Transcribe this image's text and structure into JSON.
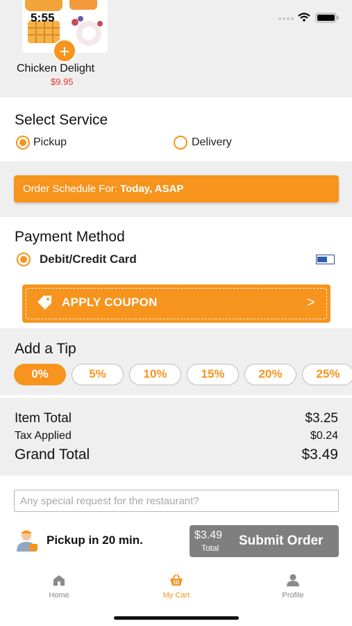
{
  "status_bar": {
    "time": "5:55"
  },
  "cart_item": {
    "name": "Chicken Delight",
    "price": "$9.95",
    "add_label": "+"
  },
  "service": {
    "title": "Select Service",
    "options": [
      {
        "label": "Pickup",
        "selected": true
      },
      {
        "label": "Delivery",
        "selected": false
      }
    ]
  },
  "schedule": {
    "prefix": "Order Schedule For:",
    "value": "Today, ASAP"
  },
  "payment": {
    "title": "Payment Method",
    "method": "Debit/Credit Card",
    "card_icon": "credit-card-icon"
  },
  "coupon": {
    "label": "APPLY COUPON",
    "chevron": ">"
  },
  "tip": {
    "title": "Add a Tip",
    "options": [
      "0%",
      "5%",
      "10%",
      "15%",
      "20%",
      "25%"
    ],
    "selected": "0%"
  },
  "totals": {
    "item_total_label": "Item Total",
    "item_total": "$3.25",
    "tax_label": "Tax Applied",
    "tax": "$0.24",
    "grand_total_label": "Grand Total",
    "grand_total": "$3.49"
  },
  "request": {
    "placeholder": "Any special request for the restaurant?"
  },
  "pickup": {
    "label": "Pickup in 20 min."
  },
  "submit": {
    "price": "$3.49",
    "total_label": "Total",
    "label": "Submit Order"
  },
  "tabs": [
    {
      "label": "Home",
      "icon": "home-icon",
      "active": false
    },
    {
      "label": "My Cart",
      "icon": "basket-icon",
      "active": true
    },
    {
      "label": "Profile",
      "icon": "person-icon",
      "active": false
    }
  ],
  "colors": {
    "accent": "#f7941d",
    "price_red": "#e8332d",
    "submit_grey": "#7f7f7f",
    "section_grey": "#efefef"
  }
}
